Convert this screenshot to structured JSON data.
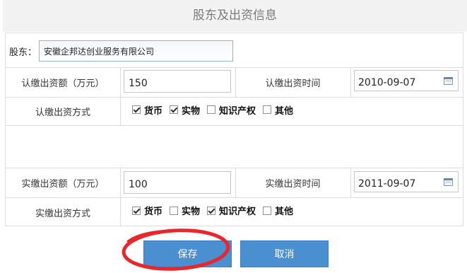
{
  "page_title": "股东及出资信息",
  "shareholder": {
    "label": "股东：",
    "value": "安徽企邦达创业服务有限公司"
  },
  "subscribed": {
    "amount_label": "认缴出资额（万元）",
    "amount_value": "150",
    "time_label": "认缴出资时间",
    "time_value": "2010-09-07",
    "method_label": "认缴出资方式",
    "options": [
      {
        "label": "货币",
        "checked": true
      },
      {
        "label": "实物",
        "checked": true
      },
      {
        "label": "知识产权",
        "checked": false
      },
      {
        "label": "其他",
        "checked": false
      }
    ]
  },
  "paid": {
    "amount_label": "实缴出资额（万元）",
    "amount_value": "100",
    "time_label": "实缴出资时间",
    "time_value": "2011-09-07",
    "method_label": "实缴出资方式",
    "options": [
      {
        "label": "货币",
        "checked": true
      },
      {
        "label": "实物",
        "checked": false
      },
      {
        "label": "知识产权",
        "checked": true
      },
      {
        "label": "其他",
        "checked": false
      }
    ]
  },
  "buttons": {
    "save": "保存",
    "cancel": "取消"
  },
  "colors": {
    "button": "#4a8fd0",
    "annotation": "#e8262b",
    "border": "#dcdcdc",
    "header_bg": "#f2f2f2"
  },
  "icons": {
    "date_picker": "calendar-icon"
  }
}
